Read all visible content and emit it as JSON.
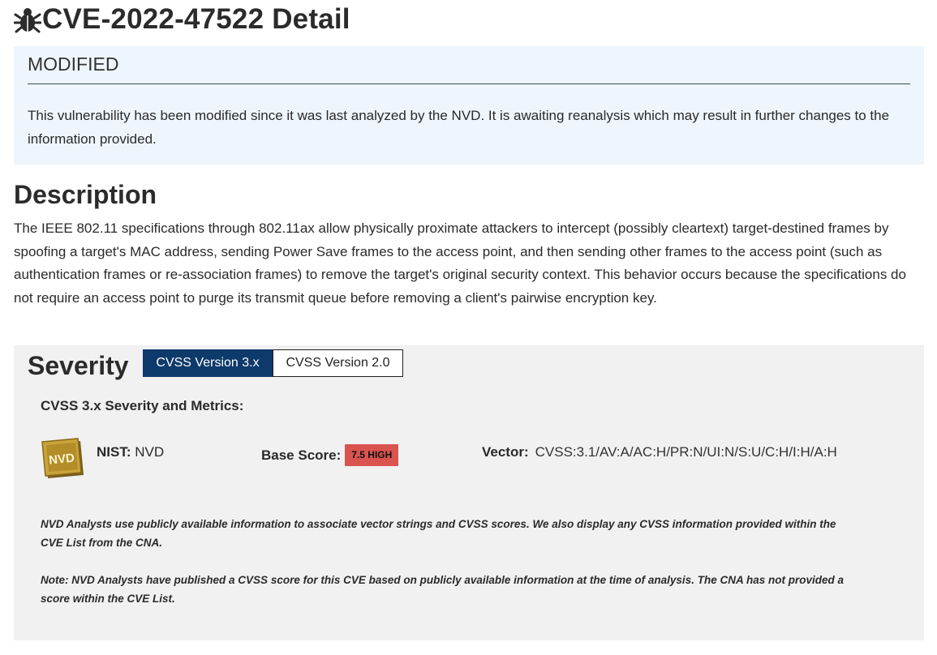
{
  "page": {
    "title": "CVE-2022-47522 Detail",
    "title_icon": "bug-icon"
  },
  "modified": {
    "heading": "MODIFIED",
    "text": "This vulnerability has been modified since it was last analyzed by the NVD. It is awaiting reanalysis which may result in further changes to the information provided."
  },
  "description": {
    "heading": "Description",
    "text": "The IEEE 802.11 specifications through 802.11ax allow physically proximate attackers to intercept (possibly cleartext) target-destined frames by spoofing a target's MAC address, sending Power Save frames to the access point, and then sending other frames to the access point (such as authentication frames or re-association frames) to remove the target's original security context. This behavior occurs because the specifications do not require an access point to purge its transmit queue before removing a client's pairwise encryption key."
  },
  "severity": {
    "heading": "Severity",
    "tabs": [
      {
        "label": "CVSS Version 3.x",
        "active": true
      },
      {
        "label": "CVSS Version 2.0",
        "active": false
      }
    ],
    "metrics_title": "CVSS 3.x Severity and Metrics:",
    "source_label": "NIST:",
    "source_value": "NVD",
    "logo_text": "NVD",
    "base_score_label": "Base Score:",
    "base_score_badge": "7.5 HIGH",
    "badge_color": "#d9534f",
    "vector_label": "Vector:",
    "vector_value": "CVSS:3.1/AV:A/AC:H/PR:N/UI:N/S:U/C:H/I:H/A:H",
    "note1": "NVD Analysts use publicly available information to associate vector strings and CVSS scores. We also display any CVSS information provided within the CVE List from the CNA.",
    "note2": "Note: NVD Analysts have published a CVSS score for this CVE based on publicly available information at the time of analysis. The CNA has not provided a score within the CVE List."
  },
  "colors": {
    "notice_bg": "#eef5fc",
    "active_tab": "#0e3a6b",
    "severity_bg": "#f1f1f1"
  }
}
